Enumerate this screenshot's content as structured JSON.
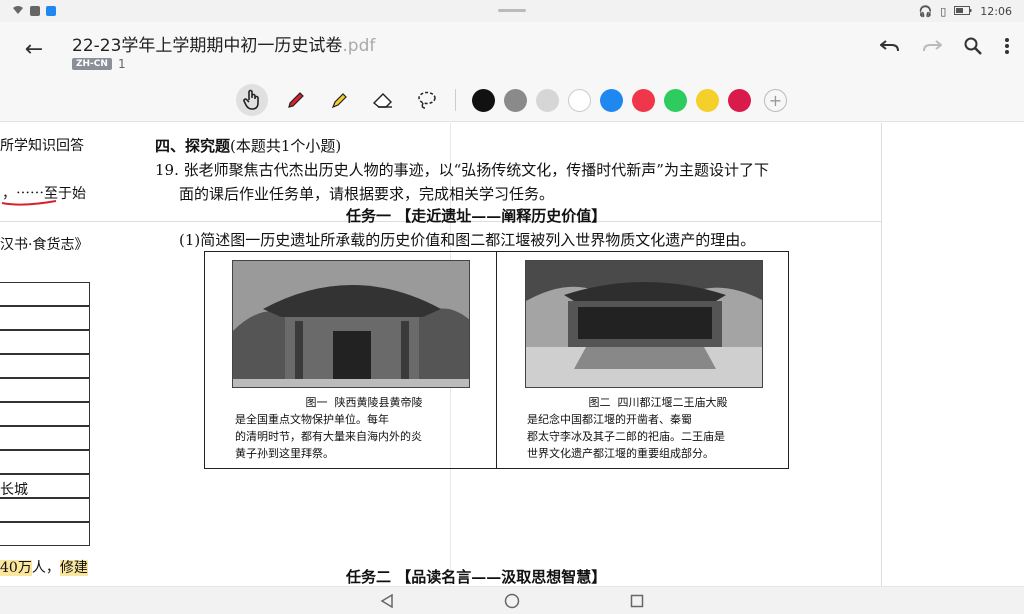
{
  "status": {
    "time": "12:06"
  },
  "header": {
    "title": "22-23学年上学期期中初一历史试卷",
    "extension": ".pdf",
    "lang_badge": "ZH-CN",
    "page_count": "1"
  },
  "toolbar": {
    "tools": [
      "hand-icon",
      "pen-icon",
      "highlighter-icon",
      "eraser-icon",
      "lasso-icon"
    ],
    "colors": [
      "#111111",
      "#8a8a8a",
      "#d6d6d6",
      "#ffffff",
      "#1e88f0",
      "#f0364a",
      "#2ecc5e",
      "#f5cf2a",
      "#d81b4a"
    ],
    "add_label": "+"
  },
  "doc": {
    "left_fragments": [
      "所学知识回答",
      "，⋯⋯至于始",
      "汉书·食货志》",
      "长城",
      "40万",
      "人，",
      "修建"
    ],
    "section_heading": "四、探究题",
    "section_note": "(本题共1个小题)",
    "q_line1": "19. 张老师聚焦古代杰出历史人物的事迹，以“弘扬传统文化，传播时代新声”为主题设计了下",
    "q_line2": "面的课后作业任务单，请根据要求，完成相关学习任务。",
    "task1": "任务一 【走近遗址——阐释历史价值】",
    "task1_q": "(1)简述图一历史遗址所承载的历史价值和图二都江堰被列入世界物质文化遗产的理由。",
    "fig1_title": "图一  陕西黄陵县黄帝陵",
    "fig1_text": "是全国重点文物保护单位。每年\n的清明时节，都有大量来自海内外的炎\n黄子孙到这里拜祭。",
    "fig2_title": "图二  四川都江堰二王庙大殿",
    "fig2_text": "是纪念中国都江堰的开凿者、秦蜀\n郡太守李冰及其子二郎的祀庙。二王庙是\n世界文化遗产都江堰的重要组成部分。",
    "task2": "任务二 【品读名言——汲取思想智慧】"
  }
}
